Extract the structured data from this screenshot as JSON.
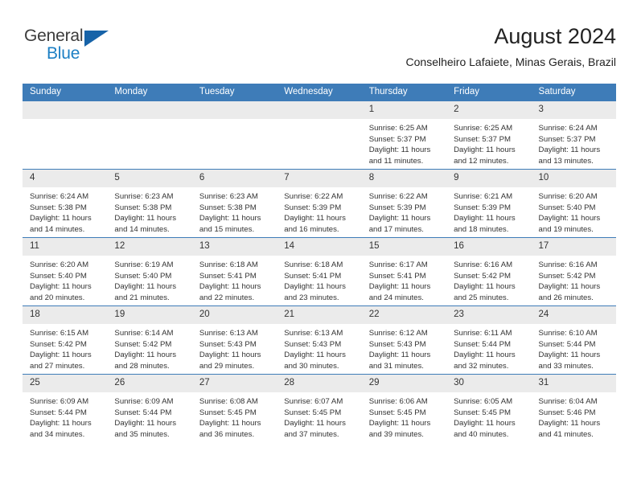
{
  "brand": {
    "name_part1": "General",
    "name_part2": "Blue",
    "triangle_color": "#1763a8",
    "blue_color": "#1c7fc4"
  },
  "header": {
    "title": "August 2024",
    "subtitle": "Conselheiro Lafaiete, Minas Gerais, Brazil"
  },
  "theme": {
    "header_bg": "#3e7cb8",
    "daynum_bg": "#ebebeb",
    "row_border": "#3e7cb8"
  },
  "weekdays": [
    "Sunday",
    "Monday",
    "Tuesday",
    "Wednesday",
    "Thursday",
    "Friday",
    "Saturday"
  ],
  "weeks": [
    [
      {
        "day": "",
        "sunrise": "",
        "sunset": "",
        "daylight1": "",
        "daylight2": ""
      },
      {
        "day": "",
        "sunrise": "",
        "sunset": "",
        "daylight1": "",
        "daylight2": ""
      },
      {
        "day": "",
        "sunrise": "",
        "sunset": "",
        "daylight1": "",
        "daylight2": ""
      },
      {
        "day": "",
        "sunrise": "",
        "sunset": "",
        "daylight1": "",
        "daylight2": ""
      },
      {
        "day": "1",
        "sunrise": "Sunrise: 6:25 AM",
        "sunset": "Sunset: 5:37 PM",
        "daylight1": "Daylight: 11 hours",
        "daylight2": "and 11 minutes."
      },
      {
        "day": "2",
        "sunrise": "Sunrise: 6:25 AM",
        "sunset": "Sunset: 5:37 PM",
        "daylight1": "Daylight: 11 hours",
        "daylight2": "and 12 minutes."
      },
      {
        "day": "3",
        "sunrise": "Sunrise: 6:24 AM",
        "sunset": "Sunset: 5:37 PM",
        "daylight1": "Daylight: 11 hours",
        "daylight2": "and 13 minutes."
      }
    ],
    [
      {
        "day": "4",
        "sunrise": "Sunrise: 6:24 AM",
        "sunset": "Sunset: 5:38 PM",
        "daylight1": "Daylight: 11 hours",
        "daylight2": "and 14 minutes."
      },
      {
        "day": "5",
        "sunrise": "Sunrise: 6:23 AM",
        "sunset": "Sunset: 5:38 PM",
        "daylight1": "Daylight: 11 hours",
        "daylight2": "and 14 minutes."
      },
      {
        "day": "6",
        "sunrise": "Sunrise: 6:23 AM",
        "sunset": "Sunset: 5:38 PM",
        "daylight1": "Daylight: 11 hours",
        "daylight2": "and 15 minutes."
      },
      {
        "day": "7",
        "sunrise": "Sunrise: 6:22 AM",
        "sunset": "Sunset: 5:39 PM",
        "daylight1": "Daylight: 11 hours",
        "daylight2": "and 16 minutes."
      },
      {
        "day": "8",
        "sunrise": "Sunrise: 6:22 AM",
        "sunset": "Sunset: 5:39 PM",
        "daylight1": "Daylight: 11 hours",
        "daylight2": "and 17 minutes."
      },
      {
        "day": "9",
        "sunrise": "Sunrise: 6:21 AM",
        "sunset": "Sunset: 5:39 PM",
        "daylight1": "Daylight: 11 hours",
        "daylight2": "and 18 minutes."
      },
      {
        "day": "10",
        "sunrise": "Sunrise: 6:20 AM",
        "sunset": "Sunset: 5:40 PM",
        "daylight1": "Daylight: 11 hours",
        "daylight2": "and 19 minutes."
      }
    ],
    [
      {
        "day": "11",
        "sunrise": "Sunrise: 6:20 AM",
        "sunset": "Sunset: 5:40 PM",
        "daylight1": "Daylight: 11 hours",
        "daylight2": "and 20 minutes."
      },
      {
        "day": "12",
        "sunrise": "Sunrise: 6:19 AM",
        "sunset": "Sunset: 5:40 PM",
        "daylight1": "Daylight: 11 hours",
        "daylight2": "and 21 minutes."
      },
      {
        "day": "13",
        "sunrise": "Sunrise: 6:18 AM",
        "sunset": "Sunset: 5:41 PM",
        "daylight1": "Daylight: 11 hours",
        "daylight2": "and 22 minutes."
      },
      {
        "day": "14",
        "sunrise": "Sunrise: 6:18 AM",
        "sunset": "Sunset: 5:41 PM",
        "daylight1": "Daylight: 11 hours",
        "daylight2": "and 23 minutes."
      },
      {
        "day": "15",
        "sunrise": "Sunrise: 6:17 AM",
        "sunset": "Sunset: 5:41 PM",
        "daylight1": "Daylight: 11 hours",
        "daylight2": "and 24 minutes."
      },
      {
        "day": "16",
        "sunrise": "Sunrise: 6:16 AM",
        "sunset": "Sunset: 5:42 PM",
        "daylight1": "Daylight: 11 hours",
        "daylight2": "and 25 minutes."
      },
      {
        "day": "17",
        "sunrise": "Sunrise: 6:16 AM",
        "sunset": "Sunset: 5:42 PM",
        "daylight1": "Daylight: 11 hours",
        "daylight2": "and 26 minutes."
      }
    ],
    [
      {
        "day": "18",
        "sunrise": "Sunrise: 6:15 AM",
        "sunset": "Sunset: 5:42 PM",
        "daylight1": "Daylight: 11 hours",
        "daylight2": "and 27 minutes."
      },
      {
        "day": "19",
        "sunrise": "Sunrise: 6:14 AM",
        "sunset": "Sunset: 5:42 PM",
        "daylight1": "Daylight: 11 hours",
        "daylight2": "and 28 minutes."
      },
      {
        "day": "20",
        "sunrise": "Sunrise: 6:13 AM",
        "sunset": "Sunset: 5:43 PM",
        "daylight1": "Daylight: 11 hours",
        "daylight2": "and 29 minutes."
      },
      {
        "day": "21",
        "sunrise": "Sunrise: 6:13 AM",
        "sunset": "Sunset: 5:43 PM",
        "daylight1": "Daylight: 11 hours",
        "daylight2": "and 30 minutes."
      },
      {
        "day": "22",
        "sunrise": "Sunrise: 6:12 AM",
        "sunset": "Sunset: 5:43 PM",
        "daylight1": "Daylight: 11 hours",
        "daylight2": "and 31 minutes."
      },
      {
        "day": "23",
        "sunrise": "Sunrise: 6:11 AM",
        "sunset": "Sunset: 5:44 PM",
        "daylight1": "Daylight: 11 hours",
        "daylight2": "and 32 minutes."
      },
      {
        "day": "24",
        "sunrise": "Sunrise: 6:10 AM",
        "sunset": "Sunset: 5:44 PM",
        "daylight1": "Daylight: 11 hours",
        "daylight2": "and 33 minutes."
      }
    ],
    [
      {
        "day": "25",
        "sunrise": "Sunrise: 6:09 AM",
        "sunset": "Sunset: 5:44 PM",
        "daylight1": "Daylight: 11 hours",
        "daylight2": "and 34 minutes."
      },
      {
        "day": "26",
        "sunrise": "Sunrise: 6:09 AM",
        "sunset": "Sunset: 5:44 PM",
        "daylight1": "Daylight: 11 hours",
        "daylight2": "and 35 minutes."
      },
      {
        "day": "27",
        "sunrise": "Sunrise: 6:08 AM",
        "sunset": "Sunset: 5:45 PM",
        "daylight1": "Daylight: 11 hours",
        "daylight2": "and 36 minutes."
      },
      {
        "day": "28",
        "sunrise": "Sunrise: 6:07 AM",
        "sunset": "Sunset: 5:45 PM",
        "daylight1": "Daylight: 11 hours",
        "daylight2": "and 37 minutes."
      },
      {
        "day": "29",
        "sunrise": "Sunrise: 6:06 AM",
        "sunset": "Sunset: 5:45 PM",
        "daylight1": "Daylight: 11 hours",
        "daylight2": "and 39 minutes."
      },
      {
        "day": "30",
        "sunrise": "Sunrise: 6:05 AM",
        "sunset": "Sunset: 5:45 PM",
        "daylight1": "Daylight: 11 hours",
        "daylight2": "and 40 minutes."
      },
      {
        "day": "31",
        "sunrise": "Sunrise: 6:04 AM",
        "sunset": "Sunset: 5:46 PM",
        "daylight1": "Daylight: 11 hours",
        "daylight2": "and 41 minutes."
      }
    ]
  ]
}
